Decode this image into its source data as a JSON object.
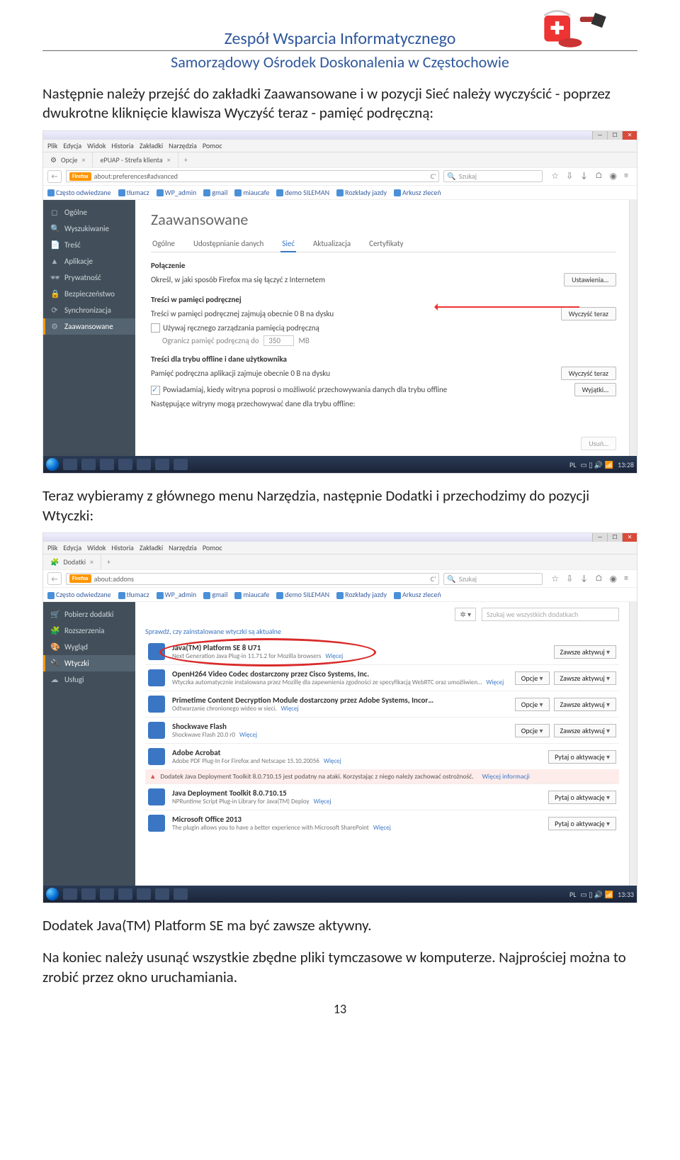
{
  "header": {
    "title": "Zespół Wsparcia Informatycznego",
    "subtitle": "Samorządowy Ośrodek Doskonalenia w Częstochowie"
  },
  "para1": "Następnie należy przejść do zakładki Zaawansowane i w pozycji Sieć należy wyczyścić - poprzez dwukrotne kliknięcie klawisza Wyczyść teraz - pamięć podręczną:",
  "para2": "Teraz wybieramy z głównego menu Narzędzia, następnie Dodatki i przechodzimy do pozycji Wtyczki:",
  "para3": "Dodatek Java(TM) Platform SE ma być zawsze aktywny.",
  "para4": "Na koniec należy usunąć wszystkie zbędne pliki tymczasowe w komputerze. Najprościej można to zrobić przez okno uruchamiania.",
  "pagenum": "13",
  "menubar": [
    "Plik",
    "Edycja",
    "Widok",
    "Historia",
    "Zakładki",
    "Narzędzia",
    "Pomoc"
  ],
  "ss1": {
    "tabs": [
      {
        "icon": "⚙",
        "label": "Opcje"
      },
      {
        "icon": "",
        "label": "ePUAP - Strefa klienta"
      }
    ],
    "url_badge": "Firefox",
    "url": "about:preferences#advanced",
    "search_placeholder": "Szukaj",
    "bookmarks": [
      "Często odwiedzane",
      "tłumacz",
      "WP_admin",
      "gmail",
      "miaucafe",
      "demo SILEMAN",
      "Rozkłady jazdy",
      "Arkusz zleceń"
    ],
    "sidebar": [
      {
        "icon": "◻",
        "label": "Ogólne"
      },
      {
        "icon": "🔍",
        "label": "Wyszukiwanie"
      },
      {
        "icon": "📄",
        "label": "Treść"
      },
      {
        "icon": "▲",
        "label": "Aplikacje"
      },
      {
        "icon": "🕶",
        "label": "Prywatność"
      },
      {
        "icon": "🔒",
        "label": "Bezpieczeństwo"
      },
      {
        "icon": "⟳",
        "label": "Synchronizacja"
      },
      {
        "icon": "⚙",
        "label": "Zaawansowane"
      }
    ],
    "heading": "Zaawansowane",
    "subtabs": [
      "Ogólne",
      "Udostępnianie danych",
      "Sieć",
      "Aktualizacja",
      "Certyfikaty"
    ],
    "s1_title": "Połączenie",
    "s1_text": "Określ, w jaki sposób Firefox ma się łączyć z Internetem",
    "s1_btn": "Ustawienia…",
    "s2_title": "Treści w pamięci podręcznej",
    "s2_text": "Treści w pamięci podręcznej zajmują obecnie 0 B na dysku",
    "s2_btn": "Wyczyść teraz",
    "s2_chk": "Używaj ręcznego zarządzania pamięcią podręczną",
    "s2_limit_pre": "Ogranicz pamięć podręczną do",
    "s2_limit_val": "350",
    "s2_limit_suf": "MB",
    "s3_title": "Treści dla trybu offline i dane użytkownika",
    "s3_text": "Pamięć podręczna aplikacji zajmuje obecnie 0 B na dysku",
    "s3_btn": "Wyczyść teraz",
    "s3_chk": "Powiadamiaj, kiedy witryna poprosi o możliwość przechowywania danych dla trybu offline",
    "s3_btn2": "Wyjątki…",
    "s3_text2": "Następujące witryny mogą przechowywać dane dla trybu offline:",
    "s3_btn3": "Usuń…",
    "tb_lang": "PL",
    "tb_time": "13:28"
  },
  "ss2": {
    "tab": {
      "icon": "🧩",
      "label": "Dodatki"
    },
    "url_badge": "Firefox",
    "url": "about:addons",
    "search_placeholder": "Szukaj",
    "sidebar": [
      {
        "icon": "🛒",
        "label": "Pobierz dodatki"
      },
      {
        "icon": "🧩",
        "label": "Rozszerzenia"
      },
      {
        "icon": "🎨",
        "label": "Wygląd"
      },
      {
        "icon": "🔌",
        "label": "Wtyczki"
      },
      {
        "icon": "☁",
        "label": "Usługi"
      }
    ],
    "gear": "✲ ▾",
    "searchbox": "Szukaj we wszystkich dodatkach",
    "update_link": "Sprawdź, czy zainstalowane wtyczki są aktualne",
    "plugins": [
      {
        "title": "Java(TM) Platform SE 8 U71",
        "sub": "Next Generation Java Plug-in 11.71.2 for Mozilla browsers",
        "more": "Więcej",
        "actions": [
          "Zawsze aktywuj"
        ]
      },
      {
        "title": "OpenH264 Video Codec dostarczony przez Cisco Systems, Inc.",
        "sub": "Wtyczka automatycznie instalowana przez Mozillę dla zapewnienia zgodności ze specyfikacją WebRTC oraz umożliwien…",
        "more": "Więcej",
        "actions": [
          "Opcje",
          "Zawsze aktywuj"
        ]
      },
      {
        "title": "Primetime Content Decryption Module dostarczony przez Adobe Systems, Incor…",
        "sub": "Odtwarzanie chronionego wideo w sieci.",
        "more": "Więcej",
        "actions": [
          "Opcje",
          "Zawsze aktywuj"
        ]
      },
      {
        "title": "Shockwave Flash",
        "sub": "Shockwave Flash 20.0 r0",
        "more": "Więcej",
        "actions": [
          "Opcje",
          "Zawsze aktywuj"
        ]
      },
      {
        "title": "Adobe Acrobat",
        "sub": "Adobe PDF Plug-In For Firefox and Netscape 15.10.20056",
        "more": "Więcej",
        "actions": [
          "Pytaj o aktywację"
        ]
      },
      {
        "warn": true,
        "title": "Dodatek Java Deployment Toolkit 8.0.710.15 jest podatny na ataki. Korzystając z niego należy zachować ostrożność.",
        "more": "Więcej informacji"
      },
      {
        "title": "Java Deployment Toolkit 8.0.710.15",
        "sub": "NPRuntime Script Plug-in Library for Java(TM) Deploy",
        "more": "Więcej",
        "actions": [
          "Pytaj o aktywację"
        ]
      },
      {
        "title": "Microsoft Office 2013",
        "sub": "The plugin allows you to have a better experience with Microsoft SharePoint",
        "more": "Więcej",
        "actions": [
          "Pytaj o aktywację"
        ]
      }
    ],
    "tb_lang": "PL",
    "tb_time": "13:33"
  }
}
